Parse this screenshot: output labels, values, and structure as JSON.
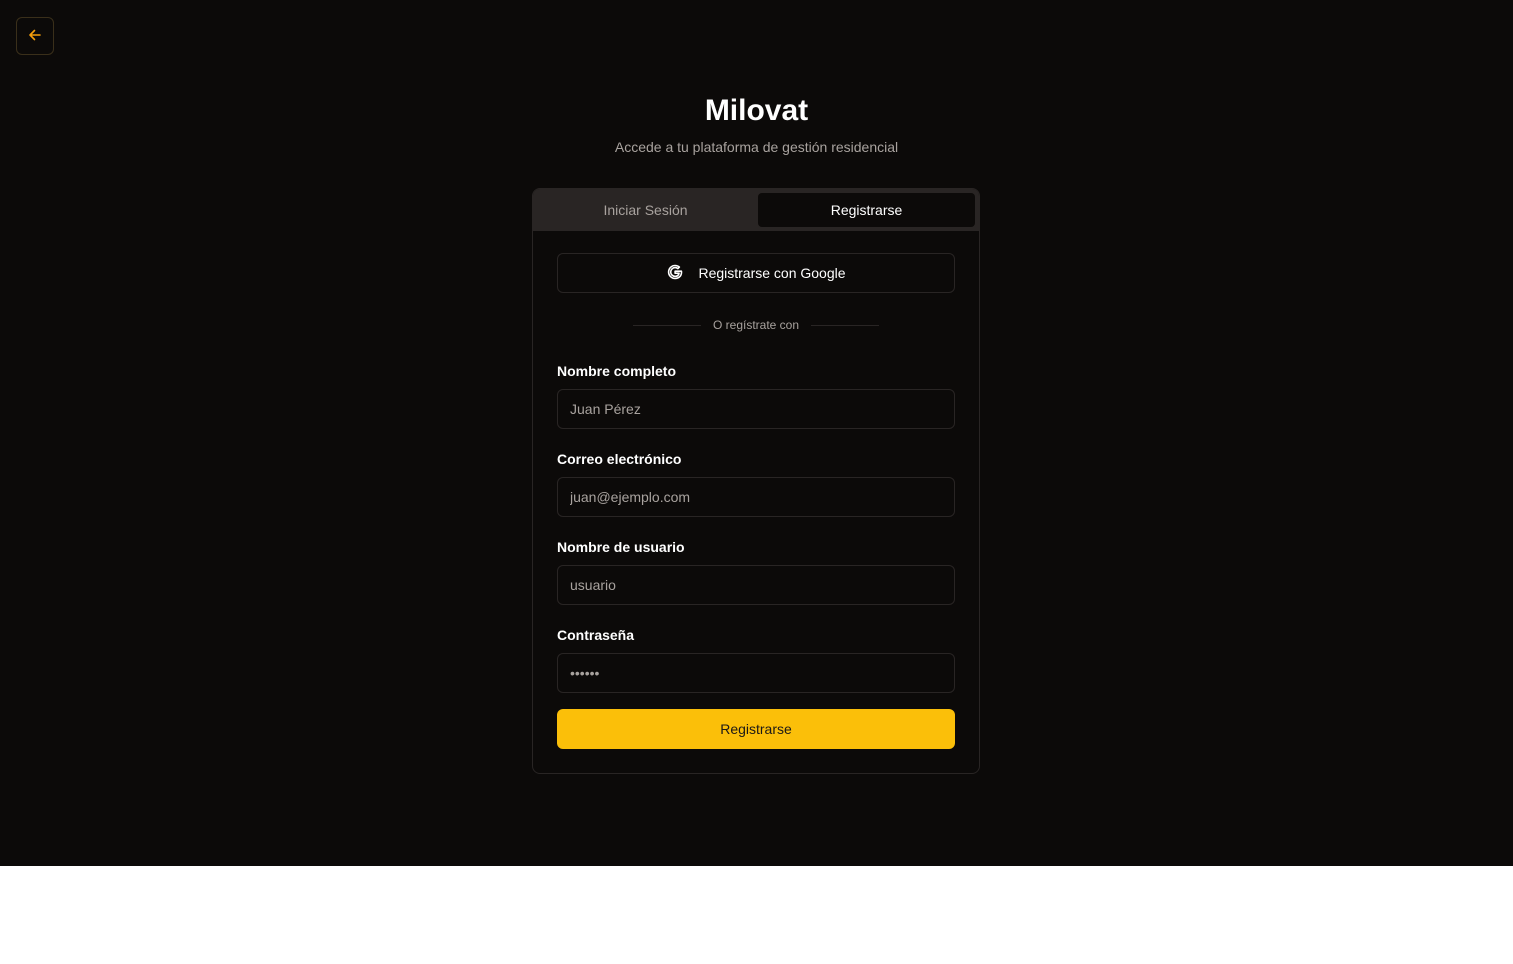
{
  "brand": {
    "title": "Milovat",
    "subtitle": "Accede a tu plataforma de gestión residencial"
  },
  "nav": {
    "back_icon": "arrow-left-icon",
    "accent_color": "#f59e0b"
  },
  "auth": {
    "tabs": [
      {
        "label": "Iniciar Sesión",
        "active": false
      },
      {
        "label": "Registrarse",
        "active": true
      }
    ],
    "google_button": {
      "label": "Registrarse con Google",
      "icon": "google-icon"
    },
    "divider_text": "O regístrate con",
    "fields": {
      "full_name": {
        "label": "Nombre completo",
        "placeholder": "Juan Pérez",
        "value": ""
      },
      "email": {
        "label": "Correo electrónico",
        "placeholder": "juan@ejemplo.com",
        "value": ""
      },
      "username": {
        "label": "Nombre de usuario",
        "placeholder": "usuario",
        "value": ""
      },
      "password": {
        "label": "Contraseña",
        "placeholder": "••••••",
        "value": ""
      }
    },
    "submit_label": "Registrarse",
    "submit_color": "#fbbf09"
  }
}
